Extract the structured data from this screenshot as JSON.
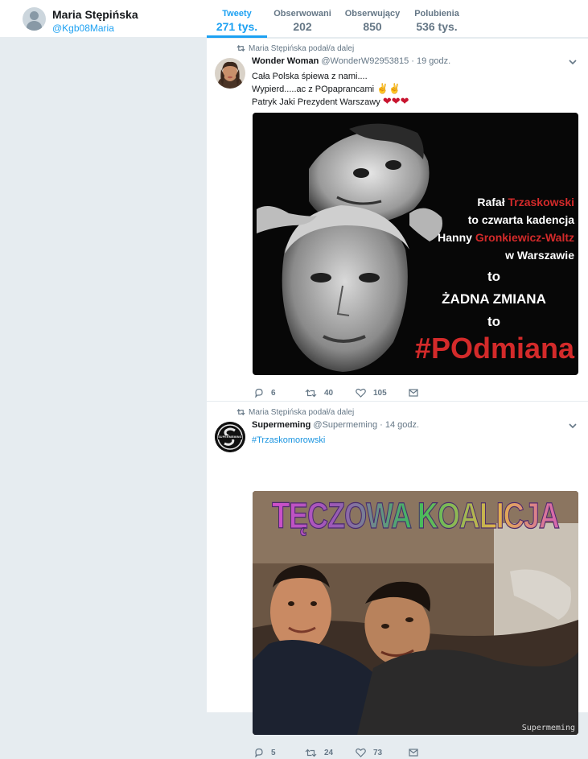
{
  "profile": {
    "name": "Maria Stępińska",
    "handle": "@Kgb08Maria"
  },
  "nav": [
    {
      "label": "Tweety",
      "value": "271 tys."
    },
    {
      "label": "Obserwowani",
      "value": "202"
    },
    {
      "label": "Obserwujący",
      "value": "850"
    },
    {
      "label": "Polubienia",
      "value": "536 tys."
    }
  ],
  "tweets": [
    {
      "retweet_label": "Maria Stępińska podał/a dalej",
      "author": "Wonder Woman",
      "handle_time": "@WonderW92953815 · 19 godz.",
      "lines": [
        "Cała Polska śpiewa z nami....",
        "Wypierd.....ac z POpaprancami",
        "Patryk Jaki Prezydent Warszawy"
      ],
      "emoji_line2": "✌✌",
      "emoji_line3": "❤❤❤",
      "image": {
        "line1_white": "Rafał ",
        "line1_red": "Trzaskowski",
        "line2": "to czwarta kadencja",
        "line3_white": "Hanny ",
        "line3_red": "Gronkiewicz-Waltz",
        "line4": "w Warszawie",
        "line5": "to",
        "line6": "ŻADNA ZMIANA",
        "line7": "to",
        "line8": "#POdmiana"
      },
      "replies": "6",
      "retweets": "40",
      "likes": "105"
    },
    {
      "retweet_label": "Maria Stępińska podał/a dalej",
      "author": "Supermeming",
      "handle_time": "@Supermeming · 14 godz.",
      "hashtag": "#Trzaskomorowski",
      "avatar_text": "SUPERMEMING",
      "image": {
        "banner": "TĘCZOWA KOALICJA",
        "watermark": "Supermeming"
      },
      "replies": "5",
      "retweets": "24",
      "likes": "73"
    }
  ],
  "colors": {
    "accent": "#1da1f2",
    "muted": "#657786",
    "background": "#e6ecf0",
    "poster_red": "#d32a2a"
  }
}
